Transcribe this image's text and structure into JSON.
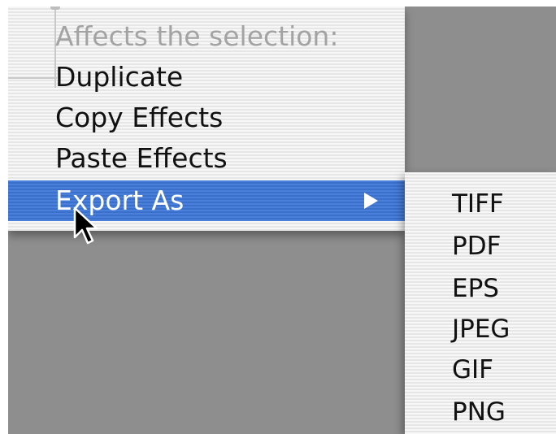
{
  "context_menu": {
    "header": "Affects the selection:",
    "items": [
      {
        "label": "Duplicate"
      },
      {
        "label": "Copy Effects"
      },
      {
        "label": "Paste Effects"
      },
      {
        "label": "Export As",
        "has_submenu": true,
        "selected": true
      }
    ]
  },
  "export_submenu": {
    "items": [
      {
        "label": "TIFF"
      },
      {
        "label": "PDF"
      },
      {
        "label": "EPS"
      },
      {
        "label": "JPEG"
      },
      {
        "label": "GIF"
      },
      {
        "label": "PNG"
      }
    ]
  },
  "colors": {
    "selection_blue": "#3d73cf",
    "background_gray": "#8e8e8e",
    "menu_stripe_light": "#f7f7f7",
    "menu_stripe_dark": "#e6e6e6",
    "disabled_text": "#a3a3a3"
  },
  "icons": {
    "submenu_arrow": "triangle-right-icon",
    "pointer": "arrow-cursor-icon"
  }
}
